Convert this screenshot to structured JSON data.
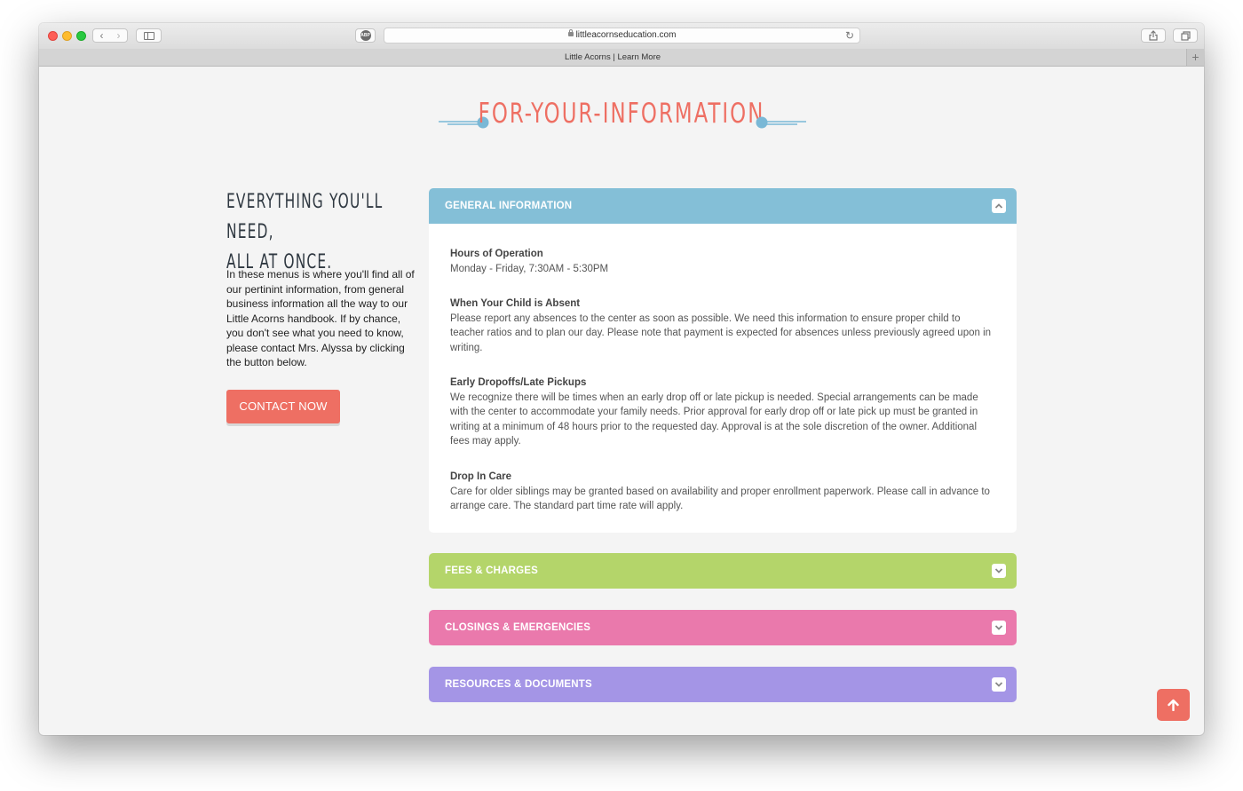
{
  "browser": {
    "url": "littleacornseducation.com",
    "tab_title": "Little Acorns | Learn More",
    "abp_label": "ABP"
  },
  "page": {
    "section_title": "FOR-YOUR-INFORMATION",
    "left": {
      "heading_line1": "EVERYTHING YOU'LL NEED,",
      "heading_line2": "ALL AT ONCE.",
      "body": "In these menus is where you'll find all of our pertinint information, from general business information all the way to our Little Acorns handbook. If by chance, you don't see what you need to know, please contact Mrs. Alyssa by clicking the button below.",
      "contact_button": "CONTACT NOW"
    },
    "accordion": [
      {
        "label": "GENERAL INFORMATION",
        "color": "#84bfd7",
        "expanded": true,
        "items": [
          {
            "heading": "Hours of Operation",
            "text": "Monday - Friday, 7:30AM - 5:30PM"
          },
          {
            "heading": "When Your Child is Absent",
            "text": "Please report any absences to the center as soon as possible. We need this information to ensure proper child to teacher ratios and to plan our day. Please note that payment is expected for absences unless previously agreed upon in writing."
          },
          {
            "heading": "Early Dropoffs/Late Pickups",
            "text": "We recognize there will be times when an early drop off or late pickup is needed. Special arrangements can be made with the center to accommodate your family needs. Prior approval for early drop off or late pick up must be granted in writing at a minimum of 48 hours prior to the requested day. Approval is at the sole discretion of the owner. Additional fees may apply."
          },
          {
            "heading": "Drop In Care",
            "text": "Care for older siblings may be granted based on availability and proper enrollment paperwork. Please call in advance to arrange care. The standard part time rate will apply."
          }
        ]
      },
      {
        "label": "FEES & CHARGES",
        "color": "#b4d56a",
        "expanded": false
      },
      {
        "label": "CLOSINGS & EMERGENCIES",
        "color": "#ea79ac",
        "expanded": false
      },
      {
        "label": "RESOURCES & DOCUMENTS",
        "color": "#a495e6",
        "expanded": false
      }
    ]
  },
  "colors": {
    "accent": "#ee6f63",
    "heading": "#2f3841",
    "deco_blue": "#7ab8d6"
  },
  "icons": [
    "back-icon",
    "forward-icon",
    "sidebar-icon",
    "lock-icon",
    "reload-icon",
    "share-icon",
    "tabs-icon",
    "new-tab-icon",
    "chevron-up-icon",
    "chevron-down-icon",
    "arrow-up-icon"
  ]
}
